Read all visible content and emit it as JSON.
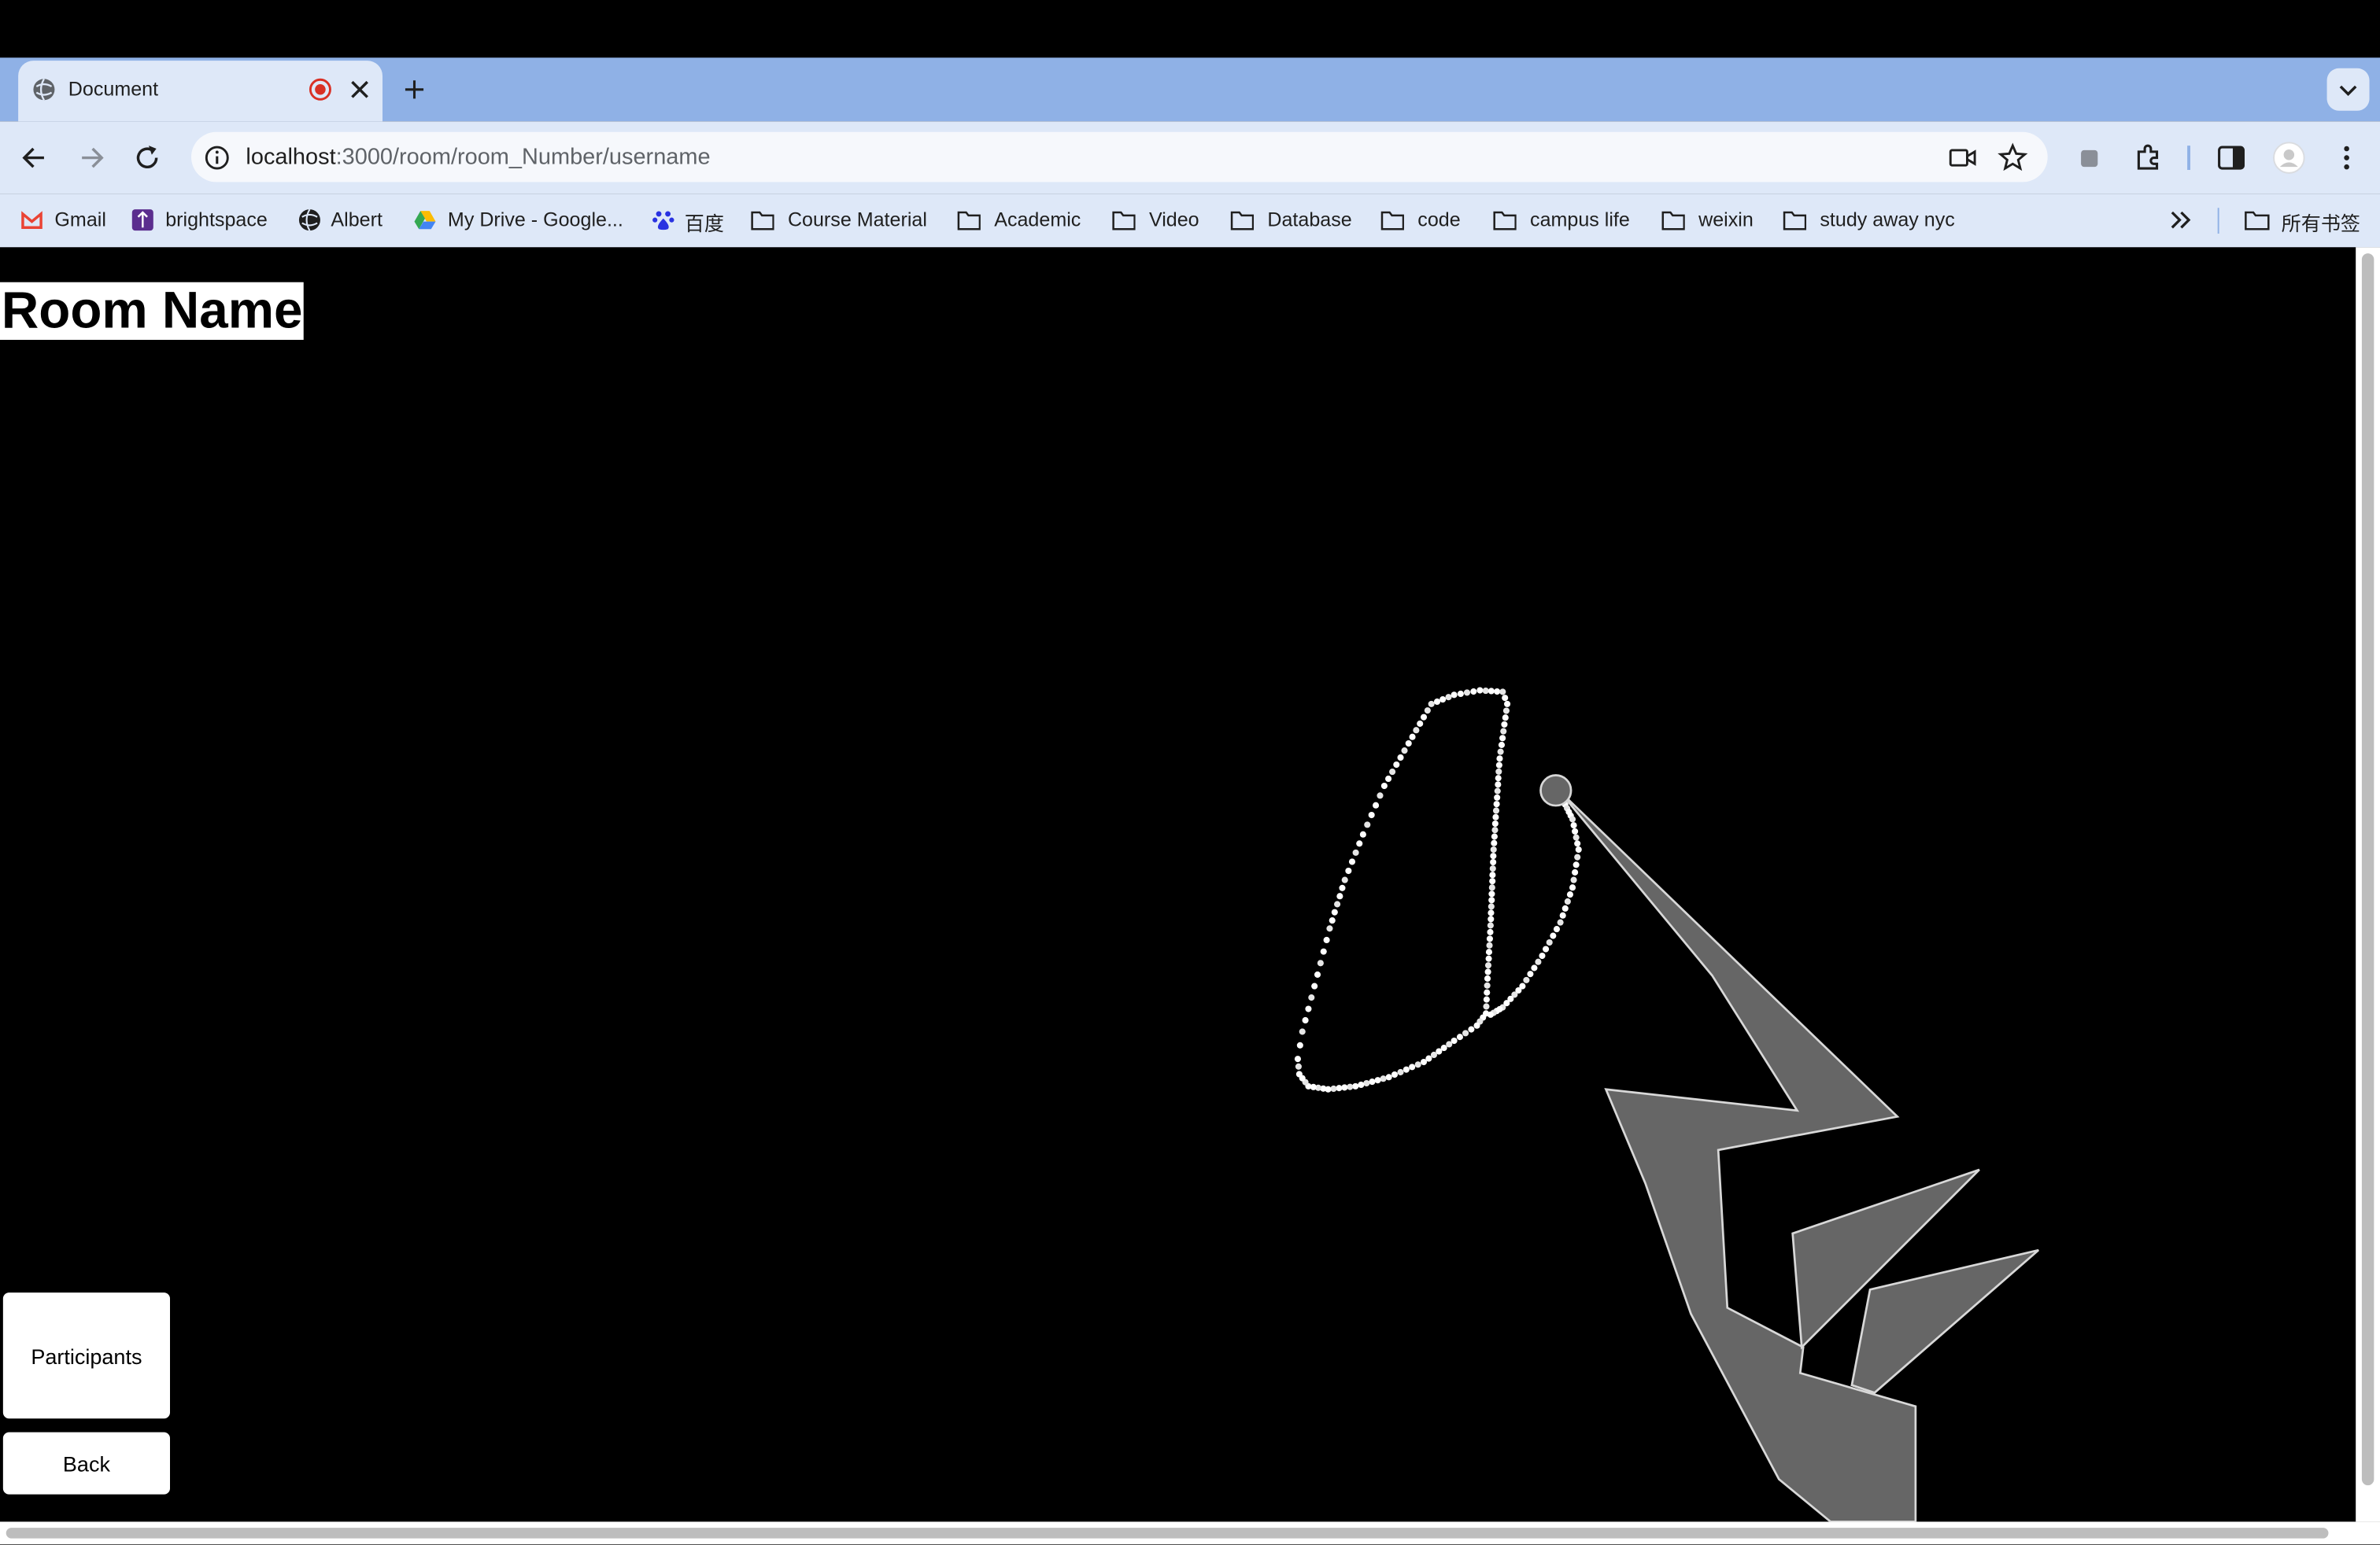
{
  "browser": {
    "tab": {
      "title": "Document"
    },
    "address_bar": {
      "host": "localhost",
      "path": ":3000/room/room_Number/username"
    },
    "bookmarks": [
      {
        "label": "Gmail",
        "icon": "gmail-icon"
      },
      {
        "label": "brightspace",
        "icon": "brightspace-icon"
      },
      {
        "label": "Albert",
        "icon": "globe-icon"
      },
      {
        "label": "My Drive - Google...",
        "icon": "google-drive-icon"
      },
      {
        "label": "百度",
        "icon": "baidu-icon"
      },
      {
        "label": "Course Material",
        "icon": "folder-icon"
      },
      {
        "label": "Academic",
        "icon": "folder-icon"
      },
      {
        "label": "Video",
        "icon": "folder-icon"
      },
      {
        "label": "Database",
        "icon": "folder-icon"
      },
      {
        "label": "code",
        "icon": "folder-icon"
      },
      {
        "label": "campus life",
        "icon": "folder-icon"
      },
      {
        "label": "weixin",
        "icon": "folder-icon"
      },
      {
        "label": "study away nyc",
        "icon": "folder-icon"
      }
    ],
    "all_bookmarks_label": "所有书签"
  },
  "page": {
    "room_title": "Room Name",
    "participants_label": "Participants",
    "back_label": "Back"
  },
  "colors": {
    "tabstrip": "#8fb1e6",
    "toolbar": "#dee8f8",
    "canvas": "#000000",
    "shape_fill": "#666666",
    "dots": "#ffffff"
  }
}
